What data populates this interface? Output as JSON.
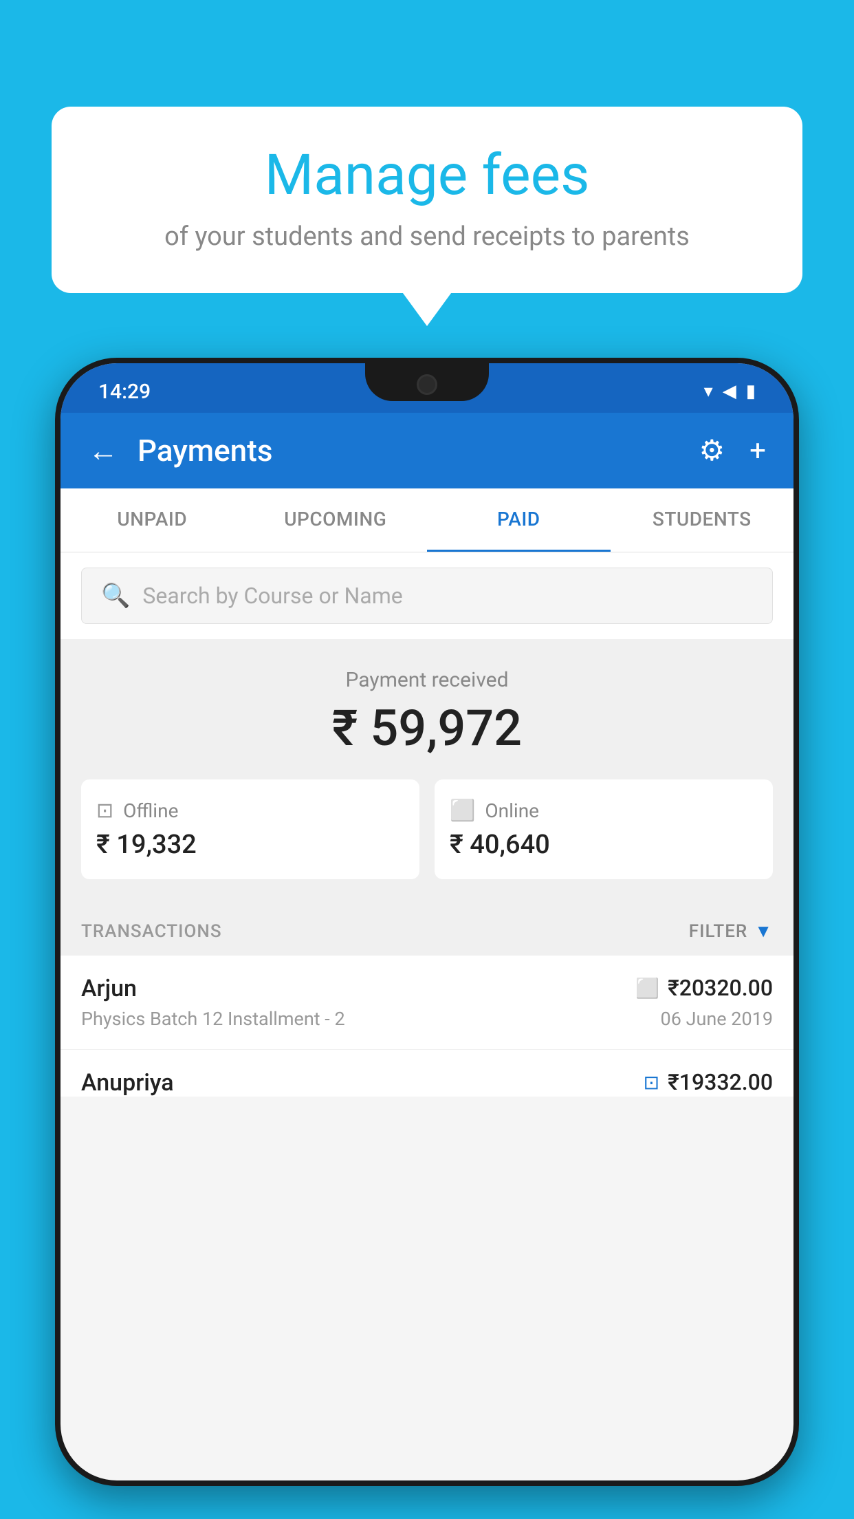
{
  "background": {
    "color": "#1BB8E8"
  },
  "bubble": {
    "title": "Manage fees",
    "subtitle": "of your students and send receipts to parents"
  },
  "statusBar": {
    "time": "14:29",
    "wifi": "▾",
    "signal": "▾",
    "battery": "▮"
  },
  "appBar": {
    "title": "Payments",
    "backLabel": "←",
    "gearLabel": "⚙",
    "addLabel": "+"
  },
  "tabs": [
    {
      "label": "UNPAID",
      "active": false
    },
    {
      "label": "UPCOMING",
      "active": false
    },
    {
      "label": "PAID",
      "active": true
    },
    {
      "label": "STUDENTS",
      "active": false
    }
  ],
  "search": {
    "placeholder": "Search by Course or Name"
  },
  "paymentSection": {
    "label": "Payment received",
    "amount": "₹ 59,972",
    "offline": {
      "type": "Offline",
      "amount": "₹ 19,332"
    },
    "online": {
      "type": "Online",
      "amount": "₹ 40,640"
    }
  },
  "transactionsSection": {
    "label": "TRANSACTIONS",
    "filterLabel": "FILTER"
  },
  "transactions": [
    {
      "name": "Arjun",
      "amount": "₹20320.00",
      "description": "Physics Batch 12 Installment - 2",
      "date": "06 June 2019",
      "paymentType": "online"
    },
    {
      "name": "Anupriya",
      "amount": "₹19332.00",
      "description": "",
      "date": "",
      "paymentType": "offline"
    }
  ]
}
